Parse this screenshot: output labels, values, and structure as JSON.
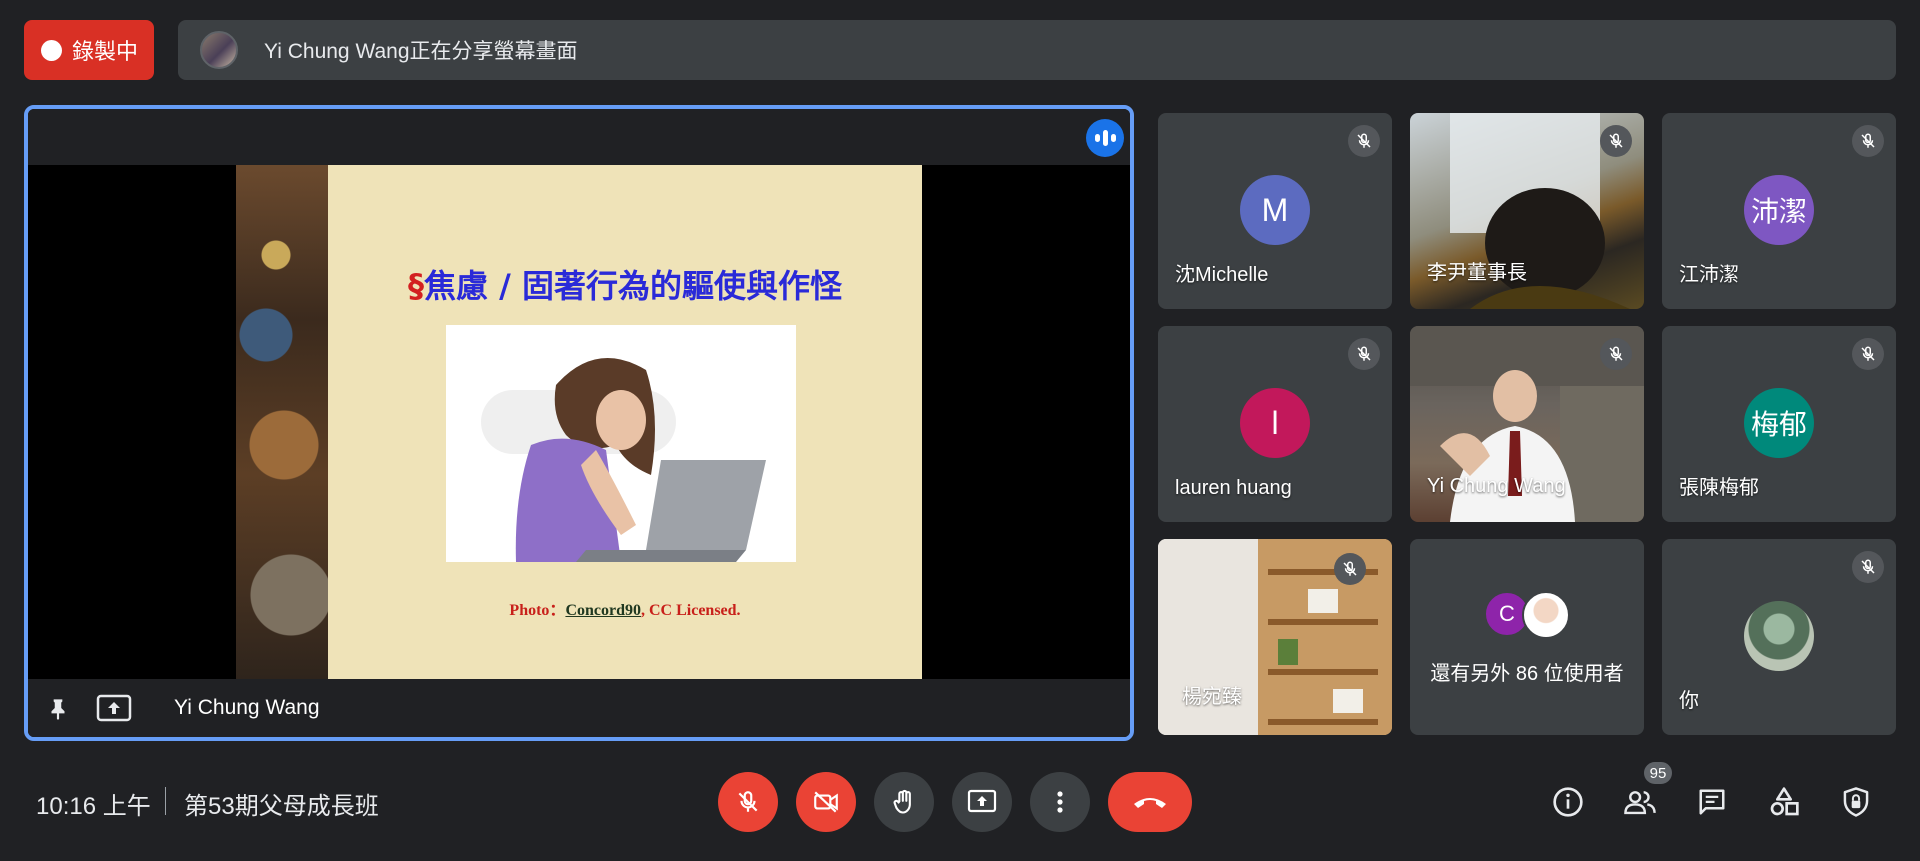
{
  "top_bar": {
    "recording_label": "錄製中",
    "share_text": "Yi Chung Wang正在分享螢幕畫面"
  },
  "presentation": {
    "presenter_name": "Yi Chung Wang",
    "slide": {
      "title_symbol": "§",
      "title": "焦慮 / 固著行為的驅使與作怪",
      "caption_prefix": "Photo：",
      "caption_link": "Concord90",
      "caption_suffix": ", CC Licensed."
    }
  },
  "participants": [
    {
      "name": "沈Michelle",
      "initial": "M",
      "avatar_color": "#5c6bc0",
      "muted": true
    },
    {
      "name": "李尹董事長",
      "video": true,
      "muted": true
    },
    {
      "name": "江沛潔",
      "initial": "沛潔",
      "avatar_color": "#7e57c2",
      "muted": true
    },
    {
      "name": "lauren huang",
      "initial": "l",
      "avatar_color": "#c2185b",
      "muted": true
    },
    {
      "name": "Yi Chung Wang",
      "video": true,
      "muted": true
    },
    {
      "name": "張陳梅郁",
      "initial": "梅郁",
      "avatar_color": "#00897b",
      "muted": true
    },
    {
      "name": "楊宛臻",
      "video": true,
      "muted": true
    },
    {
      "name": "你",
      "muted": true
    }
  ],
  "others": {
    "initial": "C",
    "text": "還有另外 86 位使用者"
  },
  "bottom_bar": {
    "time": "10:16 上午",
    "meeting_name": "第53期父母成長班",
    "people_count": "95"
  },
  "icons": {
    "mic_off": "mic-off-icon",
    "camera_off": "videocam-off-icon",
    "raise_hand": "hand-icon",
    "present": "present-icon",
    "more": "more-vert-icon",
    "hangup": "call-end-icon",
    "info": "info-icon",
    "people": "people-icon",
    "chat": "chat-icon",
    "activities": "activities-icon",
    "host_controls": "shield-lock-icon"
  },
  "colors": {
    "recording": "#d93025",
    "speaking_border": "#669df6",
    "danger": "#ea4335"
  }
}
